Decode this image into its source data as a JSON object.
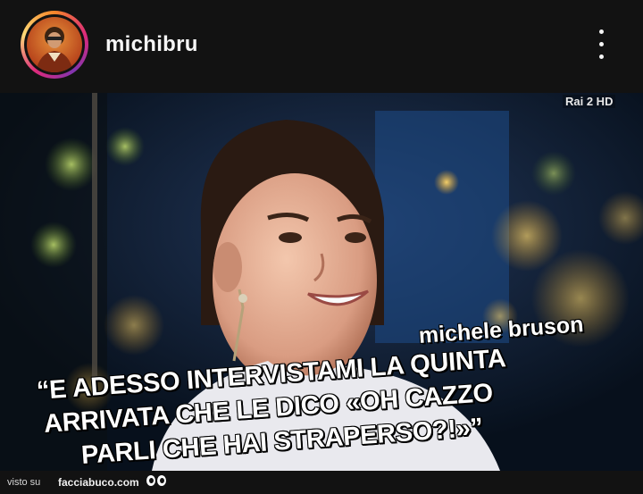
{
  "header": {
    "username": "michibru",
    "more_icon": "more-vertical-icon"
  },
  "post": {
    "channel_logo": "Rai 2 HD",
    "caption_name": "michele bruson",
    "quote_lines": [
      "“E ADESSO INTERVISTAMI LA QUINTA",
      "ARRIVATA CHE LE DICO «OH CAZZO",
      "PARLI CHE HAI STRAPERSO?!»”"
    ]
  },
  "footer": {
    "label": "visto su",
    "site": "facciabuco.com"
  }
}
